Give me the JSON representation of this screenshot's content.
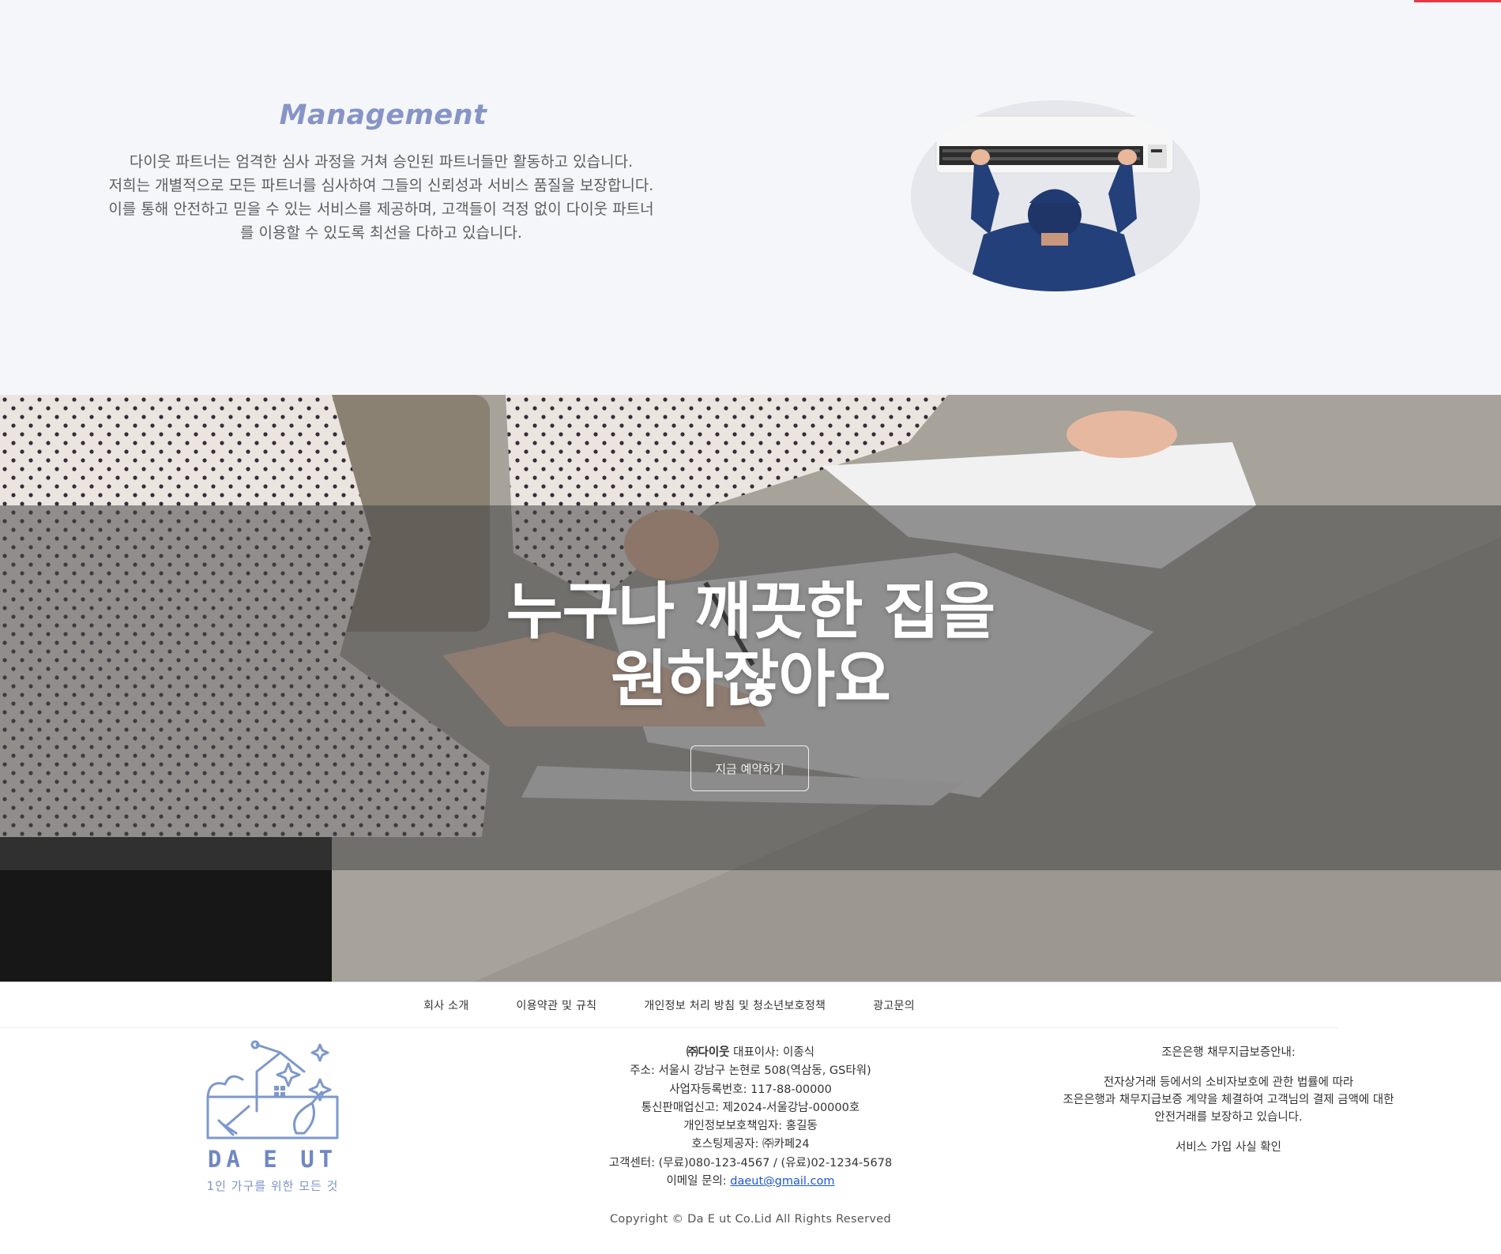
{
  "management": {
    "title": "Management",
    "desc_lines": [
      "다이웃 파트너는 엄격한 심사 과정을 거쳐 승인된 파트너들만 활동하고 있습니다.",
      "저희는 개별적으로 모든 파트너를 심사하여 그들의 신뢰성과 서비스 품질을 보장합니다.",
      "이를 통해 안전하고 믿을 수 있는 서비스를 제공하며, 고객들이 걱정 없이 다이웃 파트너",
      "를 이용할 수 있도록 최선을 다하고 있습니다."
    ]
  },
  "hero": {
    "title_line1": "누구나 깨끗한 집을",
    "title_line2": "원하잖아요",
    "button_label": "지금 예약하기"
  },
  "footer": {
    "nav": [
      "회사 소개",
      "이용약관 및 규칙",
      "개인정보 처리 방침 및 청소년보호정책",
      "광고문의"
    ],
    "logo_text": "DA E UT",
    "logo_tagline": "1인 가구를 위한 모든 것",
    "company": {
      "name": "㈜다이웃",
      "ceo": " 대표이사: 이종식",
      "address": "주소: 서울시 강남구 논현로 508(역삼동, GS타워)",
      "biz_no": "사업자등록번호: 117-88-00000",
      "mail_order": "통신판매업신고: 제2024-서울강남-00000호",
      "privacy_officer": "개인정보보호책임자: 홍길동",
      "hosting": "호스팅제공자: ㈜카페24",
      "support": "고객센터: (무료)080-123-4567 / (유료)02-1234-5678",
      "email_label": "이메일 문의: ",
      "email": "daeut@gmail.com"
    },
    "escrow": {
      "title": "조은은행 채무지급보증안내:",
      "line1": "전자상거래 등에서의 소비자보호에 관한 법률에 따라",
      "line2": "조은은행과 채무지급보증 계약을 체결하여 고객님의 결제 금액에 대한",
      "line3": "안전거래를 보장하고 있습니다.",
      "link": "서비스 가입 사실 확인"
    },
    "copyright": "Copyright © Da E ut Co.Lid All Rights Reserved"
  }
}
